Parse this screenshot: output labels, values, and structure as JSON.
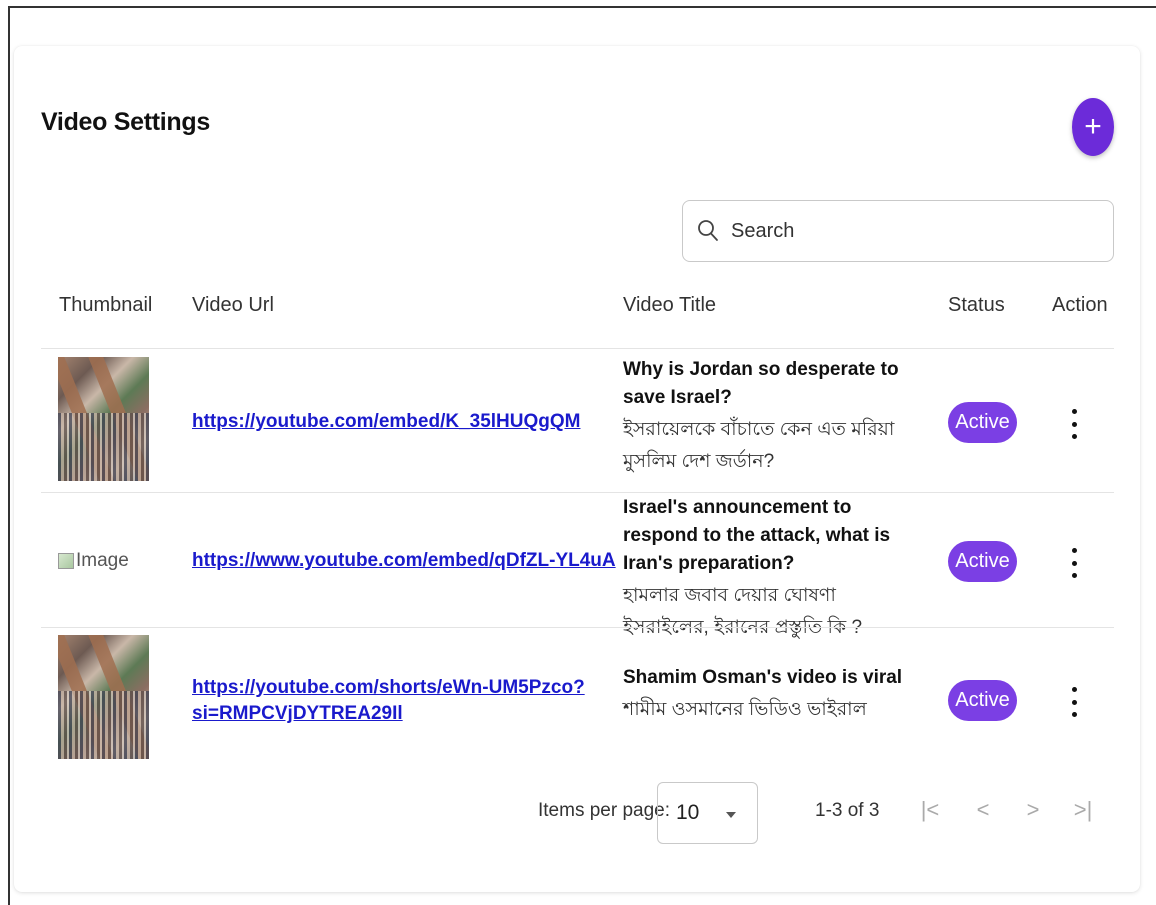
{
  "page": {
    "title": "Video Settings",
    "add_icon": "plus-icon",
    "accent_color": "#6c2bd9"
  },
  "search": {
    "placeholder": "Search",
    "icon": "search-icon"
  },
  "table": {
    "headers": {
      "thumbnail": "Thumbnail",
      "video_url": "Video Url",
      "video_title": "Video Title",
      "status": "Status",
      "action": "Action"
    },
    "rows": [
      {
        "thumbnail": "image",
        "url": "https://youtube.com/embed/K_35lHUQgQM",
        "title_en": "Why is Jordan so desperate to save Israel?",
        "title_bn": "ইসরায়েলকে বাঁচাতে কেন এত মরিয়া মুসলিম দেশ জর্ডান?",
        "status": "Active"
      },
      {
        "thumbnail_alt": "Image",
        "url": "https://www.youtube.com/embed/qDfZL-YL4uA",
        "title_en": "Israel's announcement to respond to the attack, what is Iran's preparation?",
        "title_bn": "হামলার জবাব দেয়ার ঘোষণা ইসরাইলের, ইরানের প্রস্তুতি কি ?",
        "status": "Active"
      },
      {
        "thumbnail": "image",
        "url_line1": "https://youtube.com/shorts/eWn-UM5Pzco?",
        "url_line2": "si=RMPCVjDYTREA29Il",
        "title_en": "Shamim Osman's video is viral",
        "title_bn": "শামীম ওসমানের ভিডিও ভাইরাল",
        "status": "Active"
      }
    ],
    "status_color": "#7b3fe4"
  },
  "paginator": {
    "items_per_page_label": "Items per page:",
    "items_per_page_value": "10",
    "range_label": "1-3 of 3",
    "first_icon": "first-page-icon",
    "prev_icon": "chevron-left-icon",
    "next_icon": "chevron-right-icon",
    "last_icon": "last-page-icon"
  }
}
